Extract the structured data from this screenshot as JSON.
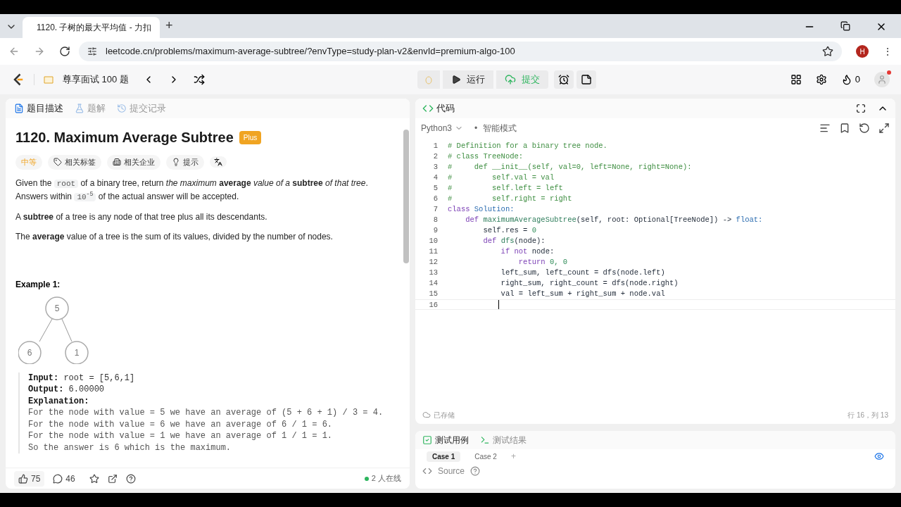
{
  "browser": {
    "tab_title": "1120. 子树的最大平均值 - 力扣",
    "new_tab": "+",
    "url": "leetcode.cn/problems/maximum-average-subtree/?envType=study-plan-v2&envId=premium-algo-100",
    "profile": "H",
    "menu": "⋮"
  },
  "nav": {
    "plan": "尊享面试 100 题",
    "run": "运行",
    "submit": "提交",
    "streak": "0"
  },
  "left_tabs": [
    {
      "label": "题目描述",
      "selected": true
    },
    {
      "label": "题解",
      "selected": false
    },
    {
      "label": "提交记录",
      "selected": false
    }
  ],
  "problem": {
    "title": "1120. Maximum Average Subtree",
    "badge": "Plus",
    "difficulty": "中等",
    "chips": [
      "相关标签",
      "相关企业",
      "提示"
    ],
    "paragraphs": [
      [
        {
          "kind": "text",
          "text": "Given the "
        },
        {
          "kind": "code",
          "text": "root"
        },
        {
          "kind": "text",
          "text": " of a binary tree, return *the maximum* **average** *value of a* **subtree** *of that tree*. Answers within "
        },
        {
          "kind": "code",
          "text": "10$^{-5}$"
        },
        {
          "kind": "text",
          "text": " of the actual answer will be accepted."
        }
      ],
      [
        {
          "kind": "text",
          "text": "A **subtree** of a tree is any node of that tree plus all its descendants."
        }
      ],
      [
        {
          "kind": "text",
          "text": "The **average** value of a tree is the sum of its values, divided by the number of nodes."
        }
      ]
    ],
    "example_title": "Example 1:",
    "tree": [
      "5",
      "6",
      "1"
    ],
    "example_lines": [
      {
        "label": "Input:",
        "text": "root = [5,6,1]"
      },
      {
        "label": "Output:",
        "text": "6.00000"
      },
      {
        "label": "Explanation:"
      }
    ],
    "explanation": [
      "For the node with value = 5 we have an average of (5 + 6 + 1) / 3 = 4.",
      "For the node with value = 6 we have an average of 6 / 1 = 6.",
      "For the node with value = 1 we have an average of 1 / 1 = 1.",
      "So the answer is 6 which is the maximum."
    ]
  },
  "left_footer": {
    "likes": "75",
    "comments": "46",
    "online": "2 人在线"
  },
  "code_panel": {
    "title": "代码",
    "language": "Python3",
    "mode_bullet": "•",
    "mode": "智能模式",
    "saved": "已存储",
    "position": "行 16，列 13",
    "lines": [
      {
        "n": "1",
        "cursor": false,
        "tokens": [
          {
            "text": "# Definition for a binary tree node.",
            "kind": "comment"
          }
        ]
      },
      {
        "n": "2",
        "cursor": false,
        "tokens": [
          {
            "text": "# class TreeNode:",
            "kind": "comment"
          }
        ]
      },
      {
        "n": "3",
        "cursor": false,
        "tokens": [
          {
            "text": "#     def __init__(self, val=0, left=None, right=None):",
            "kind": "comment"
          }
        ]
      },
      {
        "n": "4",
        "cursor": false,
        "tokens": [
          {
            "text": "#         self.val = val",
            "kind": "comment"
          }
        ]
      },
      {
        "n": "5",
        "cursor": false,
        "tokens": [
          {
            "text": "#         self.left = left",
            "kind": "comment"
          }
        ]
      },
      {
        "n": "6",
        "cursor": false,
        "tokens": [
          {
            "text": "#         self.right = right",
            "kind": "comment"
          }
        ]
      },
      {
        "n": "7",
        "cursor": false,
        "tokens": [
          {
            "text": "class ",
            "kind": "keyword"
          },
          {
            "text": "Solution:",
            "kind": "type"
          }
        ]
      },
      {
        "n": "8",
        "cursor": false,
        "tokens": [
          {
            "text": "    def ",
            "kind": "keyword"
          },
          {
            "text": "maximumAverageSubtree",
            "kind": "func"
          },
          {
            "text": "(self, root: Optional[TreeNode]) -> ",
            "kind": "plain"
          },
          {
            "text": "float:",
            "kind": "type"
          }
        ]
      },
      {
        "n": "9",
        "cursor": false,
        "tokens": [
          {
            "text": "        self.res = ",
            "kind": "plain"
          },
          {
            "text": "0",
            "kind": "number"
          }
        ]
      },
      {
        "n": "10",
        "cursor": false,
        "tokens": [
          {
            "text": "        def ",
            "kind": "keyword"
          },
          {
            "text": "dfs",
            "kind": "func"
          },
          {
            "text": "(node):",
            "kind": "plain"
          }
        ]
      },
      {
        "n": "11",
        "cursor": false,
        "tokens": [
          {
            "text": "            if not ",
            "kind": "keyword"
          },
          {
            "text": "node:",
            "kind": "plain"
          }
        ]
      },
      {
        "n": "12",
        "cursor": false,
        "tokens": [
          {
            "text": "                return ",
            "kind": "keyword"
          },
          {
            "text": "0, 0",
            "kind": "number"
          }
        ]
      },
      {
        "n": "13",
        "cursor": false,
        "tokens": [
          {
            "text": "            left_sum, left_count = dfs(node.left)",
            "kind": "plain"
          }
        ]
      },
      {
        "n": "14",
        "cursor": false,
        "tokens": [
          {
            "text": "            right_sum, right_count = dfs(node.right)",
            "kind": "plain"
          }
        ]
      },
      {
        "n": "15",
        "cursor": false,
        "tokens": [
          {
            "text": "            val = left_sum + right_sum + node.val",
            "kind": "plain"
          }
        ]
      },
      {
        "n": "16",
        "cursor": true
      }
    ]
  },
  "test_panel": {
    "tabs": [
      {
        "label": "测试用例",
        "selected": true
      },
      {
        "label": "测试结果",
        "selected": false
      }
    ],
    "cases": [
      {
        "label": "Case 1",
        "selected": true
      },
      {
        "label": "Case 2",
        "selected": false
      }
    ],
    "add": "+",
    "source": "Source"
  }
}
